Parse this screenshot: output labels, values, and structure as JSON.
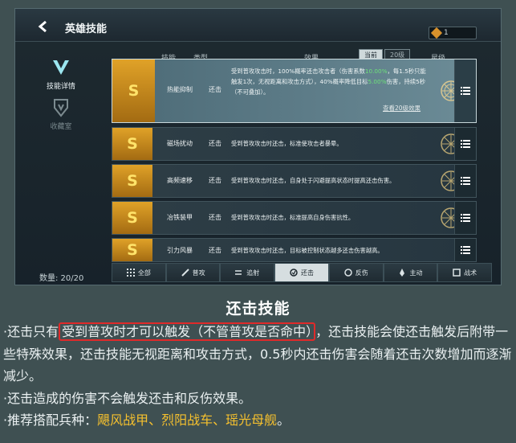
{
  "header": {
    "back_icon": "chevron-left-icon",
    "title": "英雄技能",
    "currency_value": "1"
  },
  "sidebar": {
    "items": [
      {
        "label": "技能详情",
        "active": true,
        "icon": "v-emblem-icon"
      },
      {
        "label": "收藏室",
        "active": false,
        "icon": "trophy-icon"
      }
    ],
    "count_label": "数量: 20/20"
  },
  "table": {
    "columns": {
      "skill": "技能",
      "type": "类型",
      "effect": "效果",
      "grade": "星级"
    },
    "effect_toggle": {
      "option_a": "当前",
      "option_b": "20级"
    },
    "rows": [
      {
        "grade": "S",
        "name": "热能抑制",
        "type": "还击",
        "desc_parts": [
          "受到普攻攻击时，100%概率还击攻击者（伤害系数",
          "10.00%",
          "，每1.5秒只能触发1次，无视距离和攻击方式），40%概率降低目标",
          "5.00%",
          "伤害，持续5秒（不可叠加）。"
        ],
        "link": "查看20级效果",
        "expanded": true
      },
      {
        "grade": "S",
        "name": "磁场扰动",
        "type": "还击",
        "desc": "受到普攻攻击时还击，标准使攻击者暴晕。"
      },
      {
        "grade": "S",
        "name": "高频速移",
        "type": "还击",
        "desc": "受到普攻攻击时还击，自身处于闪避提高状态时提高还击伤害。"
      },
      {
        "grade": "S",
        "name": "冶铁装甲",
        "type": "还击",
        "desc": "受到普攻攻击时还击，标准提高自身伤害抗性。"
      },
      {
        "grade": "S",
        "name": "引力风暴",
        "type": "还击",
        "desc": "受到普攻攻击时还击，目标被控制状态越多还击伤害越高。"
      }
    ]
  },
  "tabs": [
    {
      "label": "全部",
      "icon": "grid-icon",
      "active": false
    },
    {
      "label": "普攻",
      "icon": "sword-icon",
      "active": false
    },
    {
      "label": "追射",
      "icon": "arrows-icon",
      "active": false
    },
    {
      "label": "还击",
      "icon": "counter-icon",
      "active": true
    },
    {
      "label": "反伤",
      "icon": "shield-reflect-icon",
      "active": false
    },
    {
      "label": "主动",
      "icon": "flame-icon",
      "active": false
    },
    {
      "label": "战术",
      "icon": "tactic-icon",
      "active": false
    }
  ],
  "article": {
    "heading": "还击技能",
    "para1_prefix": "·还击只有",
    "para1_highlight": "受到普攻时才可以触发（不管普攻是否命中）",
    "para1_suffix": "，还击技能会使还击触发后附带一些特殊效果，还击技能无视距离和攻击方式，0.5秒内还击伤害会随着还击次数增加而逐渐减少。",
    "para2": "·还击造成的伤害不会触发还击和反伤效果。",
    "para3_prefix": "·推荐搭配兵种：",
    "para3_units": "飓风战甲、烈阳战车、瑶光母舰",
    "para3_suffix": "。"
  },
  "colors": {
    "grade_bg": "#c98a1d",
    "grade_text": "#ffe36a",
    "highlight_green": "#6de07a",
    "recommend_yellow": "#f5c02e",
    "annotation_red": "#e02a2a"
  }
}
